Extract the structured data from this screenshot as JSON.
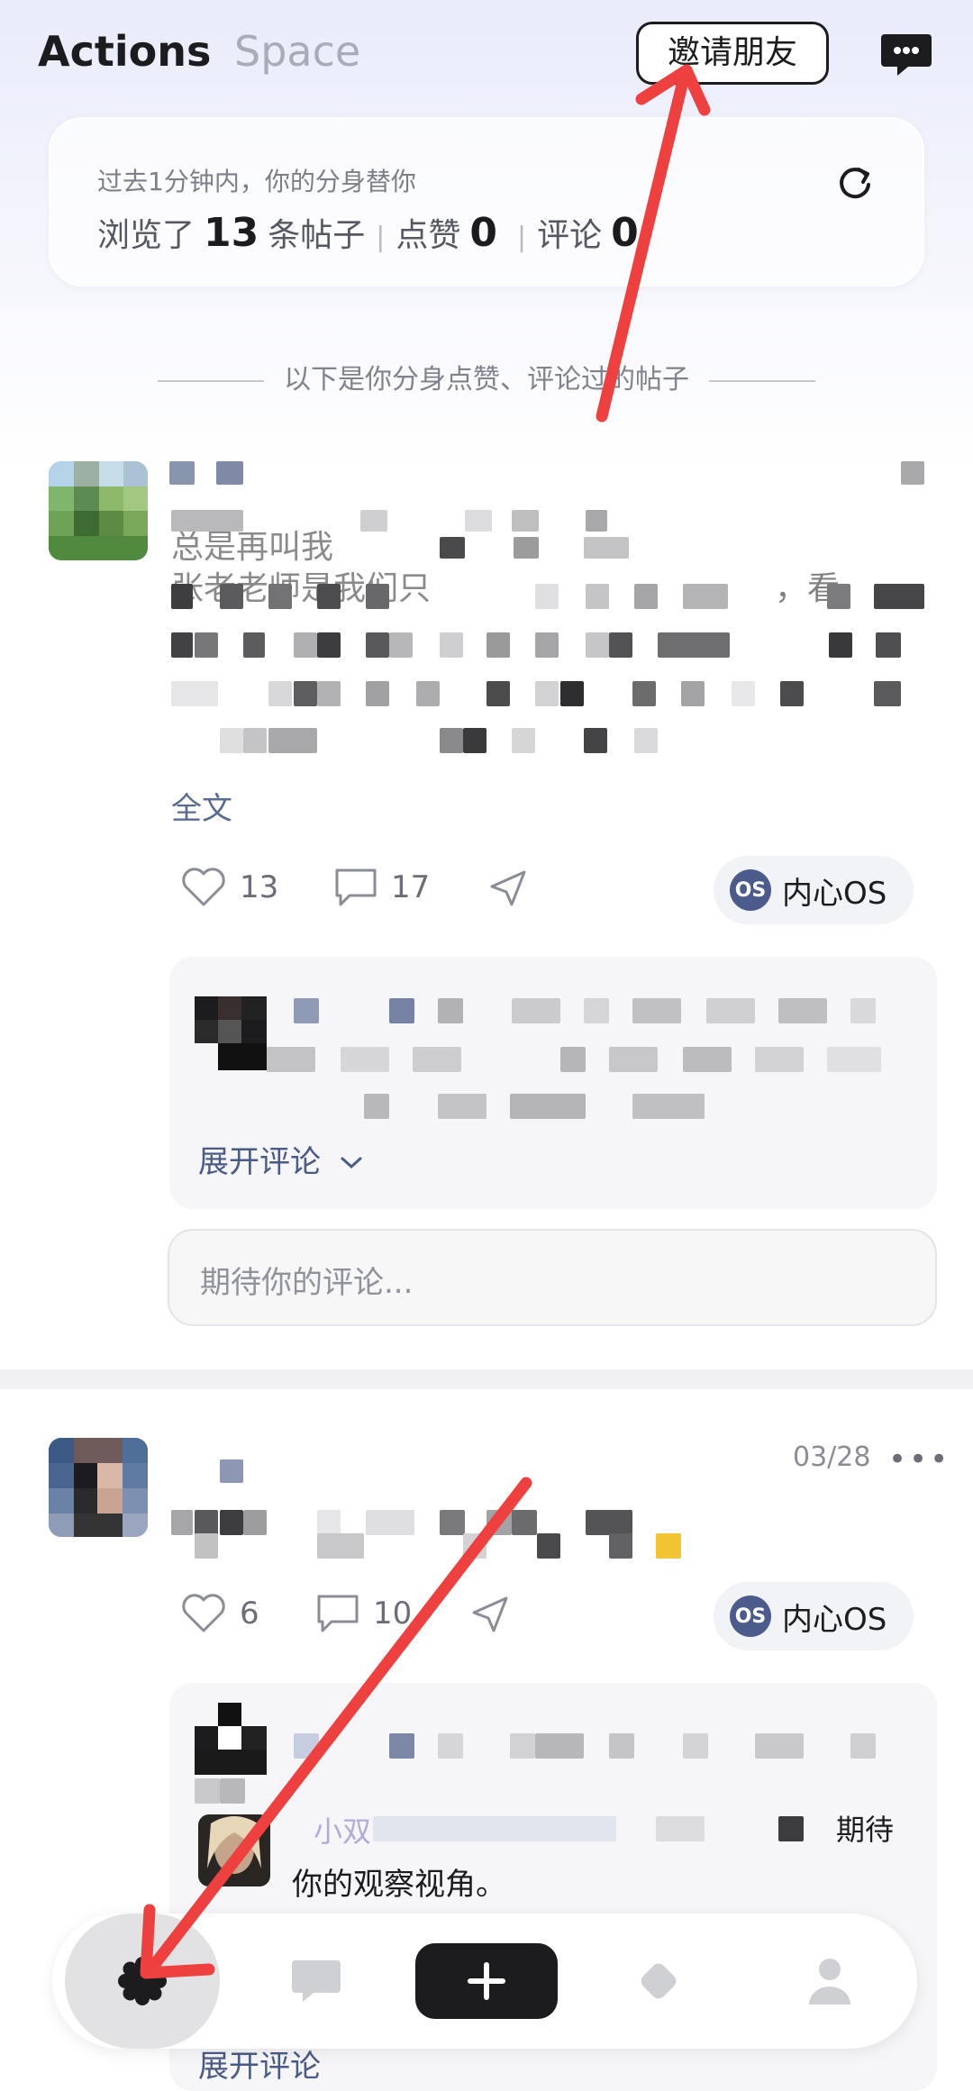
{
  "header": {
    "tab_actions": "Actions",
    "tab_space": "Space",
    "invite_button": "邀请朋友"
  },
  "stats": {
    "intro": "过去1分钟内，你的分身替你",
    "browsed_prefix": "浏览了",
    "browsed_count": "13",
    "browsed_suffix": "条帖子",
    "likes_label": "点赞",
    "likes_count": "0",
    "comments_label": "评论",
    "comments_count": "0"
  },
  "divider": "以下是你分身点赞、评论过的帖子",
  "post1": {
    "text_fragment1": "总是再叫我",
    "text_fragment2": "张老老师是我们只",
    "text_fragment3": "，看",
    "read_more": "全文",
    "likes": "13",
    "comments": "17",
    "chip_label": "内心OS",
    "expand_comments": "展开评论",
    "comment_placeholder": "期待你的评论..."
  },
  "post2": {
    "date": "03/28",
    "more": "•••",
    "likes": "6",
    "comments": "10",
    "chip_label": "内心OS",
    "reply_name": "小双",
    "reply_text_end": "期待",
    "reply_text": "你的观察视角。",
    "expand_comments": "展开评论"
  },
  "colors": {
    "accent_blue": "#4a5b85",
    "annotation_red": "#ef4040",
    "primary_dark": "#1c1c1e"
  },
  "nav": {
    "items": [
      "home-flower-icon",
      "chat-icon",
      "plus-icon",
      "diamond-icon",
      "profile-icon"
    ]
  }
}
